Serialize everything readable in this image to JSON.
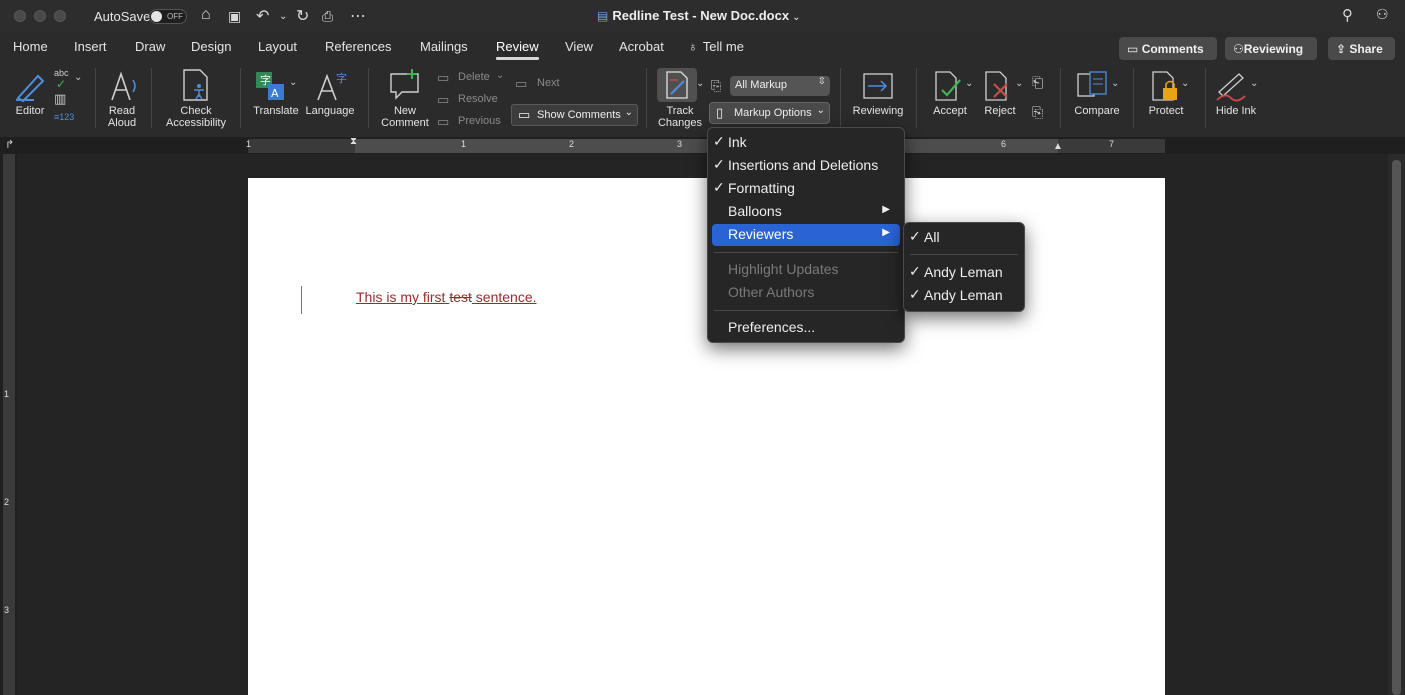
{
  "titlebar": {
    "autosave_label": "AutoSave",
    "toggle_state": "OFF",
    "doc_title": "Redline Test - New Doc.docx"
  },
  "tabs": [
    "Home",
    "Insert",
    "Draw",
    "Design",
    "Layout",
    "References",
    "Mailings",
    "Review",
    "View",
    "Acrobat",
    "Tell me"
  ],
  "active_tab": "Review",
  "header_buttons": {
    "comments": "Comments",
    "reviewing": "Reviewing",
    "share": "Share"
  },
  "ribbon": {
    "editor": "Editor",
    "spell_abc": "abc",
    "read_aloud": [
      "Read",
      "Aloud"
    ],
    "check_accessibility": [
      "Check",
      "Accessibility"
    ],
    "translate": "Translate",
    "language": "Language",
    "new_comment": [
      "New",
      "Comment"
    ],
    "delete": "Delete",
    "resolve": "Resolve",
    "previous": "Previous",
    "next": "Next",
    "show_comments": "Show Comments",
    "track_changes": [
      "Track",
      "Changes"
    ],
    "markup_select": "All Markup",
    "markup_options": "Markup Options",
    "reviewing": "Reviewing",
    "accept": "Accept",
    "reject": "Reject",
    "compare": "Compare",
    "protect": "Protect",
    "hide_ink": "Hide Ink"
  },
  "ruler_numbers": [
    "1",
    "1",
    "2",
    "3",
    "6",
    "7"
  ],
  "vruler_numbers": [
    "1",
    "2",
    "3"
  ],
  "document": {
    "before": "This is my first ",
    "deleted": "test",
    "after": " sentence."
  },
  "markup_menu": {
    "items": [
      {
        "label": "Ink",
        "checked": true
      },
      {
        "label": "Insertions and Deletions",
        "checked": true
      },
      {
        "label": "Formatting",
        "checked": true
      },
      {
        "label": "Balloons",
        "submenu": true
      },
      {
        "label": "Reviewers",
        "submenu": true,
        "selected": true
      },
      {
        "label": "Highlight Updates",
        "disabled": true
      },
      {
        "label": "Other Authors",
        "disabled": true
      },
      {
        "label": "Preferences..."
      }
    ]
  },
  "reviewers_menu": {
    "items": [
      {
        "label": "All",
        "checked": true
      },
      {
        "label": "Andy Leman",
        "checked": true
      },
      {
        "label": "Andy Leman",
        "checked": true
      }
    ]
  },
  "colors": {
    "accent_selected": "#2a63d4",
    "revision_text": "#9b2b2b",
    "background": "#2b2b2b"
  }
}
